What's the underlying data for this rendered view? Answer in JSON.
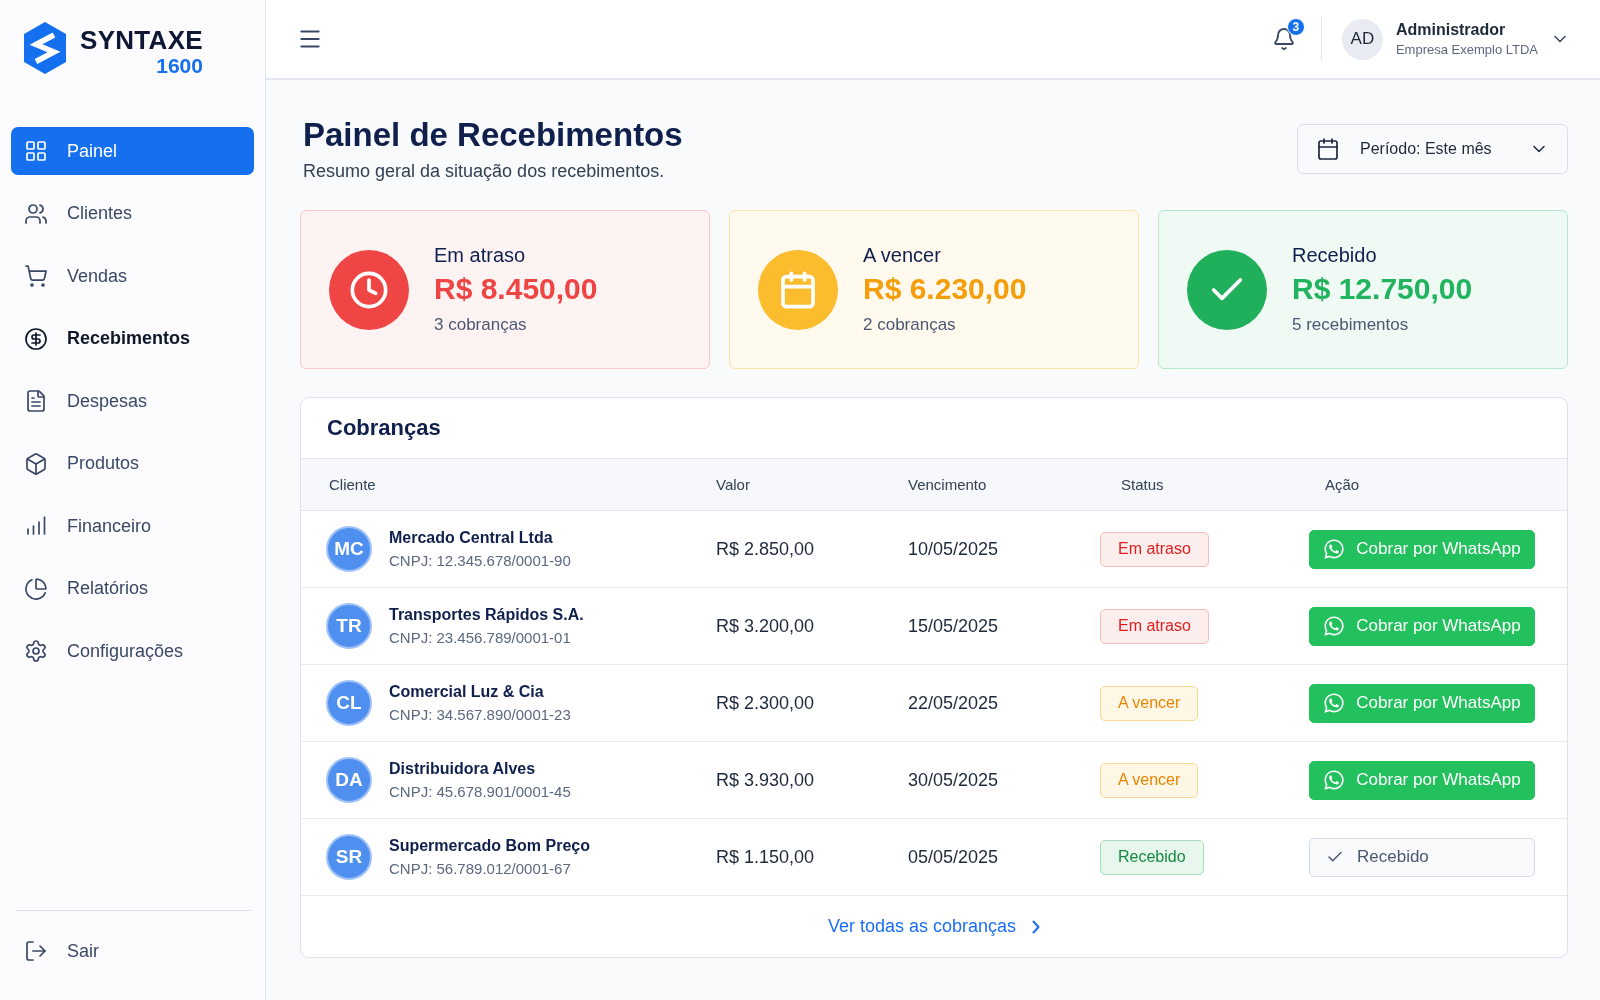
{
  "sidebar": {
    "logo": {
      "name": "SYNTAXE",
      "number": "1600"
    },
    "items": [
      {
        "label": "Painel",
        "selected": true,
        "current": false
      },
      {
        "label": "Clientes",
        "selected": false,
        "current": false
      },
      {
        "label": "Vendas",
        "selected": false,
        "current": false
      },
      {
        "label": "Recebimentos",
        "selected": false,
        "current": true
      },
      {
        "label": "Despesas",
        "selected": false,
        "current": false
      },
      {
        "label": "Produtos",
        "selected": false,
        "current": false
      },
      {
        "label": "Financeiro",
        "selected": false,
        "current": false
      },
      {
        "label": "Relatórios",
        "selected": false,
        "current": false
      },
      {
        "label": "Configurações",
        "selected": false,
        "current": false
      }
    ],
    "logout": {
      "label": "Sair"
    }
  },
  "header": {
    "notifications": {
      "count": "3"
    },
    "user": {
      "initials": "AD",
      "name": "Administrador",
      "company": "Empresa Exemplo LTDA"
    }
  },
  "page": {
    "title": "Painel de Recebimentos",
    "subtitle": "Resumo geral da situação dos recebimentos.",
    "period": {
      "label": "Período: Este mês"
    }
  },
  "summary_cards": [
    {
      "kind": "overdue",
      "label": "Em atraso",
      "amount": "R$ 8.450,00",
      "detail": "3 cobranças"
    },
    {
      "kind": "due",
      "label": "A vencer",
      "amount": "R$ 6.230,00",
      "detail": "2 cobranças"
    },
    {
      "kind": "received",
      "label": "Recebido",
      "amount": "R$ 12.750,00",
      "detail": "5 recebimentos"
    }
  ],
  "charges": {
    "title": "Cobranças",
    "columns": [
      "Cliente",
      "Valor",
      "Vencimento",
      "Status",
      "Ação"
    ],
    "rows": [
      {
        "initials": "MC",
        "name": "Mercado Central Ltda",
        "document": "CNPJ: 12.345.678/0001-90",
        "amount": "R$ 2.850,00",
        "due_date": "10/05/2025",
        "status": {
          "kind": "overdue",
          "label": "Em atraso"
        },
        "action": {
          "kind": "whatsapp",
          "label": "Cobrar por WhatsApp"
        }
      },
      {
        "initials": "TR",
        "name": "Transportes Rápidos S.A.",
        "document": "CNPJ: 23.456.789/0001-01",
        "amount": "R$ 3.200,00",
        "due_date": "15/05/2025",
        "status": {
          "kind": "overdue",
          "label": "Em atraso"
        },
        "action": {
          "kind": "whatsapp",
          "label": "Cobrar por WhatsApp"
        }
      },
      {
        "initials": "CL",
        "name": "Comercial Luz & Cia",
        "document": "CNPJ: 34.567.890/0001-23",
        "amount": "R$ 2.300,00",
        "due_date": "22/05/2025",
        "status": {
          "kind": "due",
          "label": "A vencer"
        },
        "action": {
          "kind": "whatsapp",
          "label": "Cobrar por WhatsApp"
        }
      },
      {
        "initials": "DA",
        "name": "Distribuidora Alves",
        "document": "CNPJ: 45.678.901/0001-45",
        "amount": "R$ 3.930,00",
        "due_date": "30/05/2025",
        "status": {
          "kind": "due",
          "label": "A vencer"
        },
        "action": {
          "kind": "whatsapp",
          "label": "Cobrar por WhatsApp"
        }
      },
      {
        "initials": "SR",
        "name": "Supermercado Bom Preço",
        "document": "CNPJ: 56.789.012/0001-67",
        "amount": "R$ 1.150,00",
        "due_date": "05/05/2025",
        "status": {
          "kind": "paid",
          "label": "Recebido"
        },
        "action": {
          "kind": "done",
          "label": "Recebido"
        }
      }
    ],
    "footer_link": "Ver todas as cobranças"
  }
}
